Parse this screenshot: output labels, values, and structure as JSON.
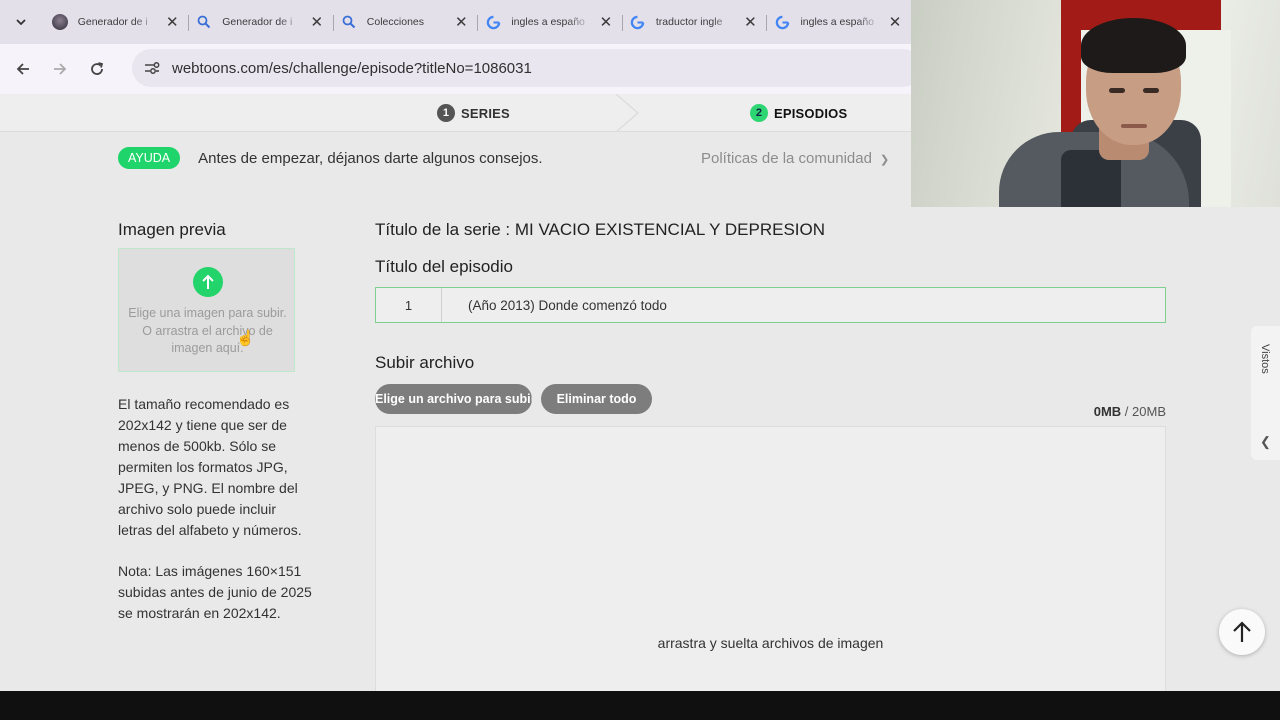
{
  "browser": {
    "tabs": [
      {
        "title": "Generador de i",
        "favicon": "avatar-icon"
      },
      {
        "title": "Generador de i",
        "favicon": "search-icon"
      },
      {
        "title": "Colecciones",
        "favicon": "search-icon"
      },
      {
        "title": "ingles a españo",
        "favicon": "google-icon"
      },
      {
        "title": "traductor ingle",
        "favicon": "google-icon"
      },
      {
        "title": "ingles a españo",
        "favicon": "google-icon"
      }
    ],
    "url": "webtoons.com/es/challenge/episode?titleNo=1086031"
  },
  "steps": [
    {
      "num": "1",
      "label": "SERIES"
    },
    {
      "num": "2",
      "label": "EPISODIOS"
    }
  ],
  "notice": {
    "badge": "AYUDA",
    "text": "Antes de empezar, déjanos darte algunos consejos.",
    "policy_link": "Políticas de la comunidad"
  },
  "preview": {
    "heading": "Imagen previa",
    "hint": "Elige una imagen para subir. O arrastra el archivo de imagen aquí.",
    "size_info": "El tamaño recomendado es 202x142 y tiene que ser de menos de 500kb. Sólo se permiten los formatos JPG, JPEG, y PNG. El nombre del archivo solo puede incluir letras del alfabeto y números.",
    "note": "Nota: Las imágenes 160×151 subidas antes de junio de 2025 se mostrarán en 202x142."
  },
  "series": {
    "title_line": "Título de la serie : MI VACIO EXISTENCIAL Y DEPRESION"
  },
  "episode": {
    "label": "Título del episodio",
    "number": "1",
    "title_value": "(Año 2013) Donde comenzó todo"
  },
  "upload": {
    "label": "Subir archivo",
    "choose_button": "Elige un archivo para subir",
    "delete_button": "Eliminar todo",
    "size_used": "0MB",
    "size_sep": " / ",
    "size_max": "20MB",
    "drop_text": "arrastra y suelta archivos de imagen"
  },
  "side_panel": {
    "label": "Vistos"
  },
  "colors": {
    "accent_green": "#1fd56b",
    "button_gray": "#7d7d7d"
  }
}
